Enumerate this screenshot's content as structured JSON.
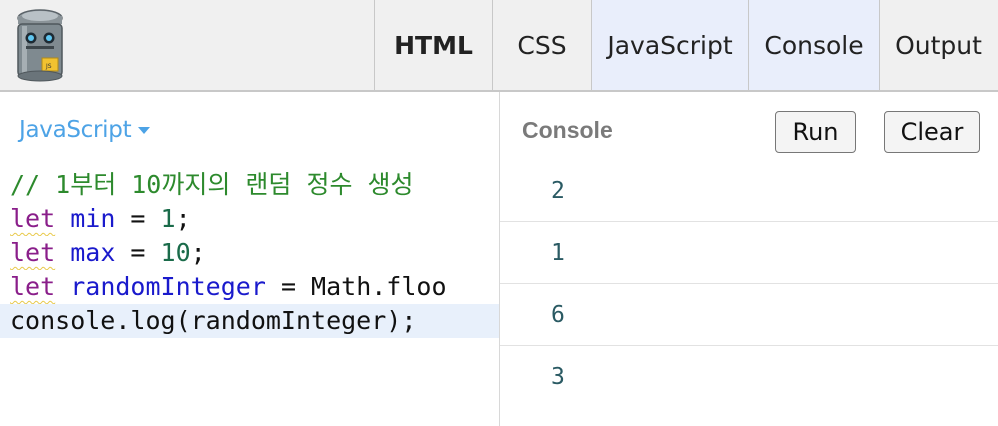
{
  "tabs": [
    {
      "label": "HTML"
    },
    {
      "label": "CSS"
    },
    {
      "label": "JavaScript"
    },
    {
      "label": "Console"
    },
    {
      "label": "Output"
    }
  ],
  "editor": {
    "language": "JavaScript",
    "lines": [
      {
        "comment": "// 1부터 10까지의 랜덤 정수 생성"
      },
      {
        "kw": "let",
        "var": "min",
        "op": " = ",
        "num": "1",
        "end": ";"
      },
      {
        "kw": "let",
        "var": "max",
        "op": " = ",
        "num": "10",
        "end": ";"
      },
      {
        "kw": "let",
        "var": "randomInteger",
        "rest": " = Math.floo"
      },
      {
        "plain": "console.log(randomInteger);"
      }
    ]
  },
  "console": {
    "title": "Console",
    "run_label": "Run",
    "clear_label": "Clear",
    "output": [
      "2",
      "1",
      "6",
      "3"
    ]
  },
  "colors": {
    "toolbar_bg": "#f0f0f0",
    "active_tab_bg": "#e9eefb",
    "link_blue": "#4da3e6",
    "keyword": "#8a1e8a",
    "variable": "#1a1acc",
    "number": "#1a6b4a",
    "comment": "#2d8a2d"
  }
}
